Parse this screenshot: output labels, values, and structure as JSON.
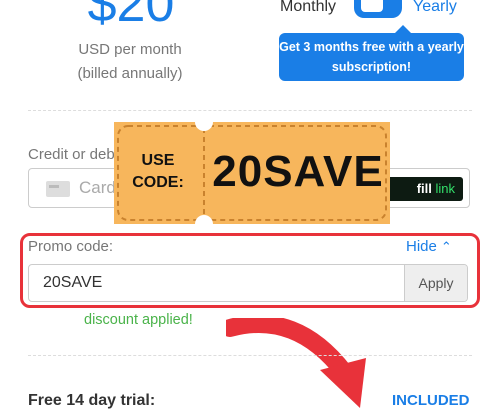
{
  "pricing": {
    "price": "$20",
    "currency_line": "USD per month",
    "billing_note": "(billed annually)"
  },
  "billing": {
    "monthly_label": "Monthly",
    "yearly_label": "Yearly",
    "selected": "Yearly",
    "tooltip": "Get 3 months free with a yearly subscription!"
  },
  "payment": {
    "card_label": "Credit or debit",
    "card_placeholder": "Card",
    "autofill_word": "fill",
    "autofill_link": "link"
  },
  "coupon_overlay": {
    "use_label": "USE",
    "code_label": "CODE:",
    "code": "20SAVE"
  },
  "promo": {
    "label": "Promo code:",
    "hide_label": "Hide",
    "value": "20SAVE",
    "apply_label": "Apply",
    "status": "discount applied!"
  },
  "trial": {
    "label": "Free 14 day trial:",
    "value": "INCLUDED"
  },
  "colors": {
    "accent": "#1a7ee6",
    "highlight": "#e8323a",
    "success": "#4ab34a",
    "coupon": "#f7b65c"
  }
}
